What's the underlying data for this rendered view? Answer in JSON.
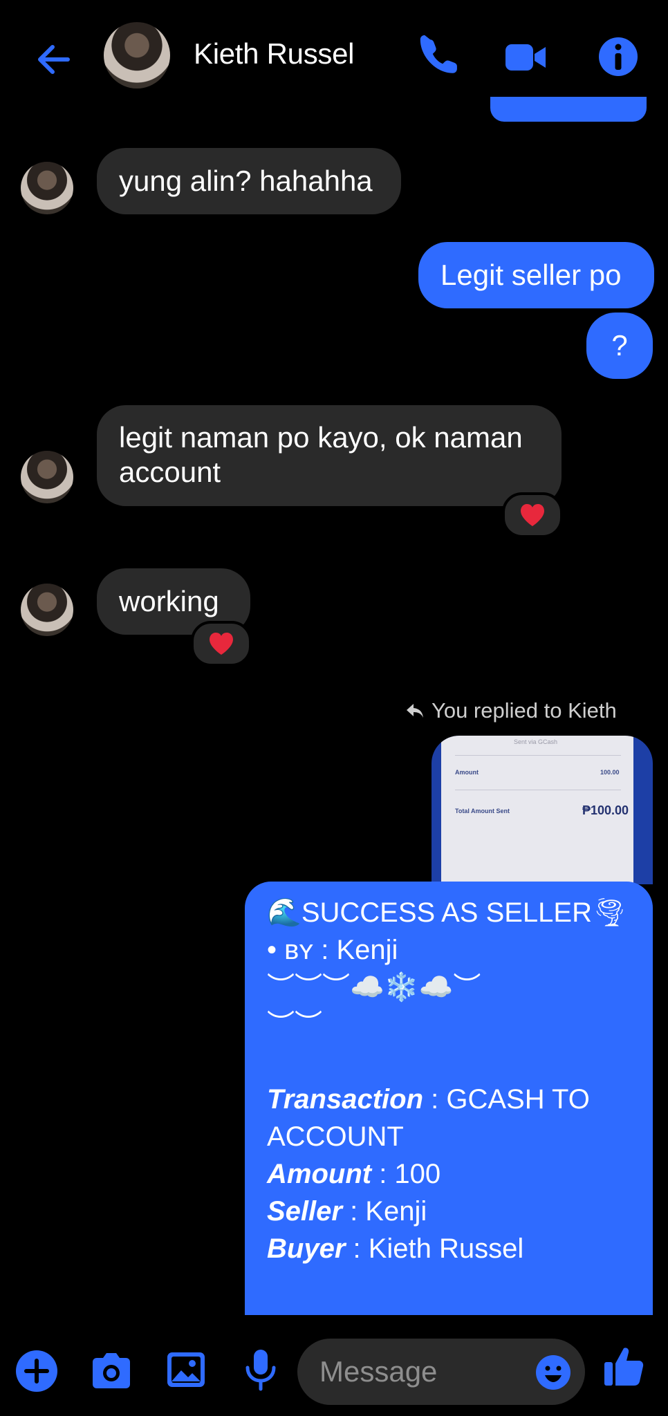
{
  "header": {
    "contact_name": "Kieth Russel",
    "back_icon": "back-arrow-icon",
    "call_icon": "phone-icon",
    "video_icon": "video-camera-icon",
    "info_icon": "info-icon"
  },
  "messages": {
    "m1": "yung alin? hahahha",
    "m2": "Legit seller po",
    "m3": "?",
    "m4_line1": "legit naman po kayo, ok naman",
    "m4_line2": "account",
    "m5": "working",
    "reply_note": "You replied to Kieth",
    "receipt": {
      "header": "Sent via GCash",
      "amount_label": "Amount",
      "amount_value": "100.00",
      "total_label": "Total Amount Sent",
      "total_value": "₱100.00"
    },
    "seller_card": {
      "title": "SUCCESS AS SELLER",
      "by_prefix": "• ʙʏ : ",
      "by_name": "Kenji",
      "deco1": "︶︶︶☁️❄️☁️︶",
      "deco2": "︶︶",
      "transaction_label": "Transaction",
      "transaction_value_line1": " : GCASH TO",
      "transaction_value_line2": "ACCOUNT",
      "amount_label": "Amount",
      "amount_value": " : 100",
      "seller_label": "Seller",
      "seller_value": " : Kenji",
      "buyer_label": "Buyer",
      "buyer_value": " : Kieth Russel"
    }
  },
  "composer": {
    "placeholder": "Message",
    "add_icon": "plus-icon",
    "camera_icon": "camera-icon",
    "gallery_icon": "image-icon",
    "mic_icon": "microphone-icon",
    "emoji_icon": "emoji-icon",
    "like_icon": "thumbs-up-icon"
  },
  "colors": {
    "accent": "#2f6bff",
    "incoming_bubble": "#2a2a2a",
    "background": "#000000",
    "reaction_heart": "#e8283c"
  }
}
